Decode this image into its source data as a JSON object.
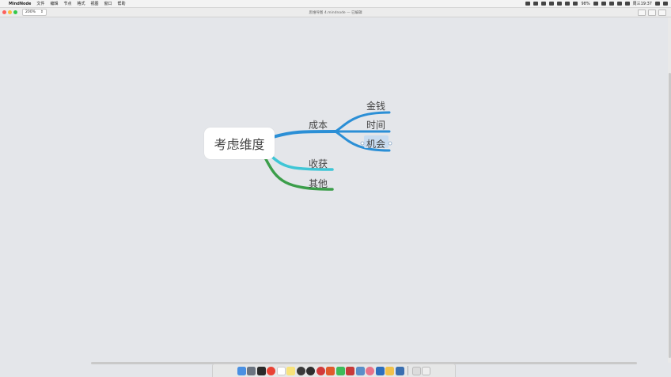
{
  "menubar": {
    "apple": "",
    "app_name": "MindNode",
    "items": [
      "文件",
      "编辑",
      "节点",
      "格式",
      "视图",
      "窗口",
      "帮助"
    ],
    "status_text": "98%",
    "clock": "周三19:37"
  },
  "window": {
    "zoom_value": "200%",
    "title": "思维导图 4.mindnode — 已编辑"
  },
  "mindmap": {
    "root": "考虑维度",
    "branches": [
      {
        "label": "成本",
        "color": "#2b8fd6",
        "children": [
          "金钱",
          "时间",
          "机会"
        ]
      },
      {
        "label": "收获",
        "color": "#3fc6d6",
        "children": []
      },
      {
        "label": "其他",
        "color": "#3b9e4a",
        "children": []
      }
    ],
    "selected": "机会"
  },
  "dock": {
    "icons": [
      "finder-icon",
      "launchpad-icon",
      "terminal-icon",
      "chrome-icon",
      "calendar-icon",
      "notes-icon",
      "activity-icon",
      "wechat-icon",
      "netease-music-icon",
      "office-icon",
      "wechat-work-icon",
      "pdf-icon",
      "preview-icon",
      "music-icon",
      "save-icon",
      "mail-icon",
      "screenshot-icon"
    ]
  }
}
